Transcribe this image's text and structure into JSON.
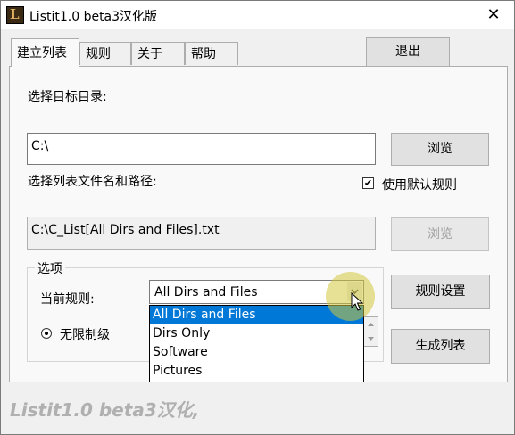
{
  "window": {
    "title": "Listit1.0 beta3汉化版",
    "close_glyph": "✕"
  },
  "tabs": [
    {
      "label": "建立列表"
    },
    {
      "label": "规则"
    },
    {
      "label": "关于"
    },
    {
      "label": "帮助"
    }
  ],
  "exit_button": "退出",
  "main": {
    "target_dir_label": "选择目标目录:",
    "target_dir_value": "C:\\",
    "browse_label": "浏览",
    "list_file_label": "选择列表文件名和路径:",
    "use_default_rules": "使用默认规则",
    "use_default_checked": true,
    "list_file_value": "C:\\C_List[All Dirs and Files].txt",
    "browse2_label": "浏览"
  },
  "options": {
    "group_title": "选项",
    "current_rule_label": "当前规则:",
    "current_rule_value": "All Dirs and Files",
    "unlimited_label": "无限制级",
    "rule_options": [
      "All Dirs and Files",
      "Dirs Only",
      "Software",
      "Pictures"
    ]
  },
  "rule_settings_button": "规则设置",
  "generate_button": "生成列表",
  "footer_text": "Listit1.0 beta3汉化,"
}
